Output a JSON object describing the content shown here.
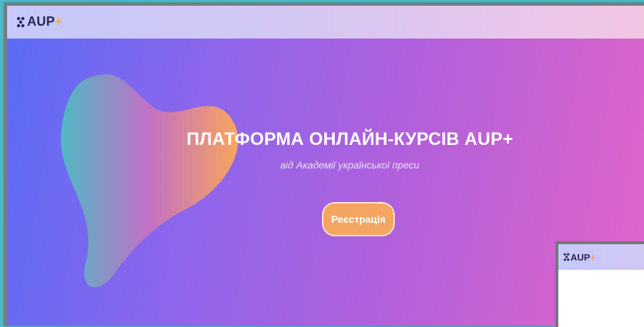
{
  "header": {
    "logo_text": "AUP",
    "logo_plus": "+"
  },
  "hero": {
    "title": "ПЛАТФОРМА ОНЛАЙН-КУРСІВ AUP+",
    "subtitle": "від Академії української преси",
    "register_label": "Реєстрація"
  },
  "preview_window": {
    "logo_text": "AUP",
    "logo_plus": "+"
  },
  "colors": {
    "accent": "#f5a562",
    "logo_dark": "#2a2558",
    "gradient_start": "#5a6cf6",
    "gradient_end": "#e064c8"
  },
  "icons": {
    "logo_mark": "hexagon-cluster-icon",
    "decorative_shape": "abstract-blob"
  }
}
